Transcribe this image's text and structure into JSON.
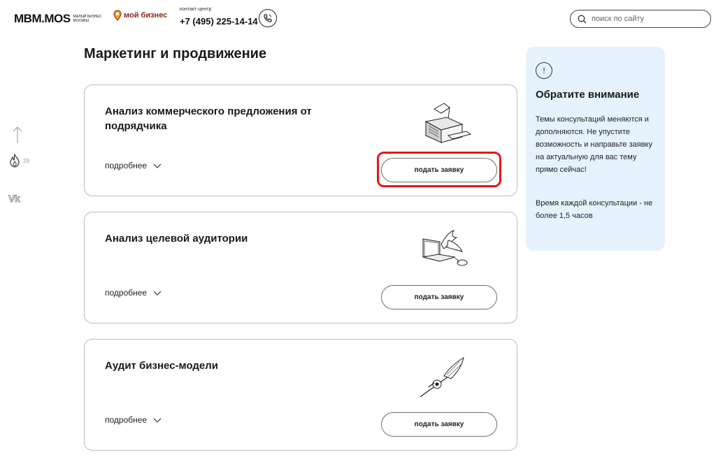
{
  "header": {
    "logo_mbm": "MBM.MOS",
    "logo_mbm_sub": "малый бизнес москвы",
    "logo_moy": "мой бизнес",
    "contact_label": "контакт-центр",
    "phone": "+7 (495) 225-14-14",
    "search_placeholder": "поиск по сайту"
  },
  "rail": {
    "likes": "29",
    "vk": "Vk"
  },
  "page_title": "Маркетинг и продвижение",
  "cards": [
    {
      "title": "Анализ коммерческого предложения от подрядчика",
      "more": "подробнее",
      "button": "подать заявку",
      "illustration": "printer-icon"
    },
    {
      "title": "Анализ целевой аудитории",
      "more": "подробнее",
      "button": "подать заявку",
      "illustration": "laptop-icon"
    },
    {
      "title": "Аудит бизнес-модели",
      "more": "подробнее",
      "button": "подать заявку",
      "illustration": "pen-icon"
    }
  ],
  "notice": {
    "title": "Обратите внимание",
    "text": "Темы консультаций меняются и дополняются. Не упустите возможность и направьте заявку на актуальную для вас тему прямо сейчас!",
    "text2": "Время каждой консультации - не более 1,5 часов"
  },
  "colors": {
    "highlight": "#e8161b",
    "notice_bg": "#e6f2fd",
    "logo_moy": "#8a2a1a"
  }
}
